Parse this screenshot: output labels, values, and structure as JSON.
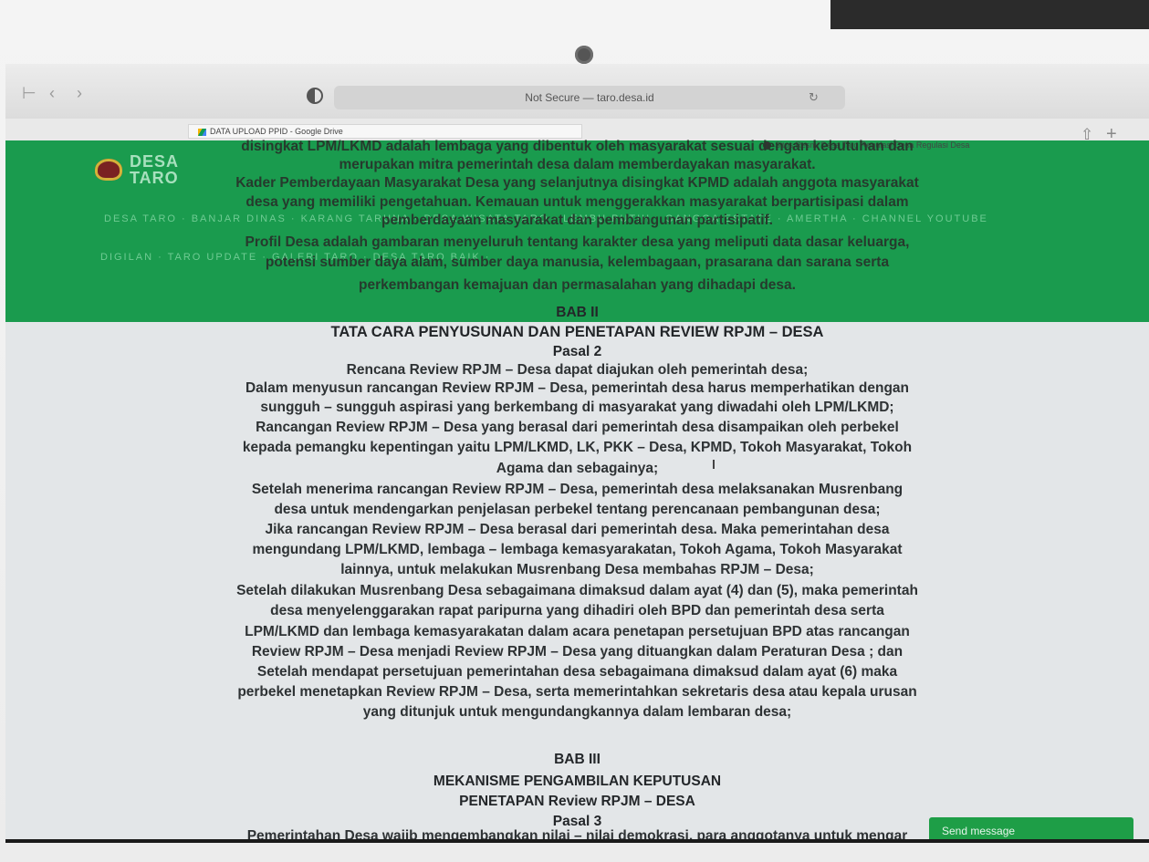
{
  "browser": {
    "address": "Not Secure — taro.desa.id",
    "bookmark_1": "DATA UPLOAD PPID - Google Drive",
    "bookmark_2": "Situs Resmi Desa Taro Regulasi Desa Regulasi Desa"
  },
  "site": {
    "logo_line1": "DESA",
    "logo_line2": "TARO",
    "menu_row_1": "DESA TARO ·  BANJAR DINAS ·  KARANG TARUNA  ·  DESA WISATA TARO  ·  LEMBU PUTIH  ·  GANGGA ESTATE  ·  AMERTHA  ·  CHANNEL YOUTUBE",
    "menu_row_2": "DIGILAN · TARO UPDATE · GALERI TARO · DESA TARO BAIK ·"
  },
  "article": {
    "overlay_lines": [
      "disingkat LPM/LKMD adalah lembaga yang dibentuk oleh masyarakat sesuai dengan kebutuhan dan",
      "merupakan mitra pemerintah desa dalam memberdayakan masyarakat.",
      "Kader Pemberdayaan Masyarakat Desa yang selanjutnya disingkat KPMD adalah anggota masyarakat",
      "desa yang memiliki pengetahuan. Kemauan untuk menggerakkan masyarakat berpartisipasi dalam",
      "pemberdayaan masyarakat dan pembangunan partisipatif.",
      "Profil Desa adalah gambaran menyeluruh tentang karakter desa yang meliputi data dasar keluarga,",
      "potensi sumber daya alam, sumber daya manusia, kelembagaan, prasarana dan sarana serta",
      "perkembangan kemajuan dan permasalahan yang dihadapi desa."
    ],
    "bab2_title": "BAB II",
    "bab2_subtitle": "TATA CARA PENYUSUNAN DAN PENETAPAN REVIEW RPJM – DESA",
    "pasal2": "Pasal 2",
    "pasal2_lines": [
      "Rencana Review RPJM – Desa dapat diajukan oleh pemerintah desa;",
      "Dalam menyusun rancangan Review RPJM – Desa, pemerintah desa harus memperhatikan dengan",
      "sungguh – sungguh aspirasi yang berkembang di masyarakat yang diwadahi oleh LPM/LKMD;",
      "Rancangan Review RPJM – Desa yang berasal dari pemerintah desa disampaikan oleh perbekel",
      "kepada pemangku kepentingan yaitu LPM/LKMD, LK, PKK – Desa, KPMD, Tokoh Masyarakat, Tokoh",
      "Agama dan sebagainya;",
      "Setelah menerima rancangan Review RPJM – Desa, pemerintah desa melaksanakan Musrenbang",
      "desa untuk mendengarkan penjelasan perbekel tentang perencanaan pembangunan desa;",
      "Jika rancangan Review RPJM – Desa berasal dari pemerintah desa. Maka pemerintahan desa",
      "mengundang LPM/LKMD, lembaga – lembaga kemasyarakatan, Tokoh Agama, Tokoh Masyarakat",
      "lainnya, untuk melakukan Musrenbang Desa membahas RPJM – Desa;",
      "Setelah dilakukan Musrenbang Desa sebagaimana dimaksud dalam ayat (4) dan (5), maka pemerintah",
      "desa menyelenggarakan rapat paripurna yang dihadiri oleh BPD dan pemerintah desa serta",
      "LPM/LKMD dan lembaga kemasyarakatan dalam acara penetapan persetujuan BPD atas rancangan",
      "Review RPJM – Desa menjadi Review RPJM – Desa yang dituangkan dalam Peraturan Desa ; dan",
      "Setelah mendapat persetujuan pemerintahan desa sebagaimana dimaksud dalam ayat (6) maka",
      "perbekel menetapkan Review RPJM – Desa, serta memerintahkan sekretaris desa atau kepala urusan",
      "yang ditunjuk untuk mengundangkannya dalam lembaran desa;"
    ],
    "bab3_title": "BAB III",
    "bab3_subtitle1": "MEKANISME PENGAMBILAN KEPUTUSAN",
    "bab3_subtitle2": "PENETAPAN Review RPJM – DESA",
    "pasal3": "Pasal 3",
    "pasal3_line1": "Pemerintahan Desa wajib mengembangkan nilai – nilai demokrasi, para anggotanya untuk mengar"
  },
  "chat": {
    "send_label": "Send message"
  }
}
